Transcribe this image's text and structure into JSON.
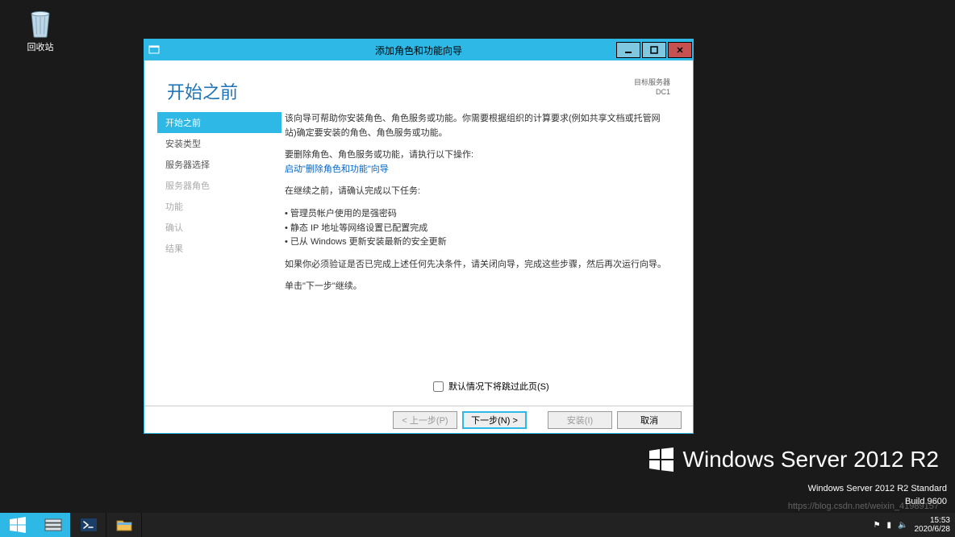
{
  "desktop": {
    "recycle_label": "回收站"
  },
  "brand": {
    "text": "Windows Server 2012 R2"
  },
  "status": {
    "edition": "Windows Server 2012 R2 Standard",
    "build": "Build 9600"
  },
  "dialog": {
    "title": "添加角色和功能向导",
    "page_title": "开始之前",
    "target_label": "目标服务器",
    "target_name": "DC1",
    "sidebar": [
      {
        "label": "开始之前",
        "state": "active"
      },
      {
        "label": "安装类型",
        "state": "done"
      },
      {
        "label": "服务器选择",
        "state": "done"
      },
      {
        "label": "服务器角色",
        "state": "disabled"
      },
      {
        "label": "功能",
        "state": "disabled"
      },
      {
        "label": "确认",
        "state": "disabled"
      },
      {
        "label": "结果",
        "state": "disabled"
      }
    ],
    "intro": "该向导可帮助你安装角色、角色服务或功能。你需要根据组织的计算要求(例如共享文档或托管网站)确定要安装的角色、角色服务或功能。",
    "remove_label": "要删除角色、角色服务或功能，请执行以下操作:",
    "remove_link": "启动\"删除角色和功能\"向导",
    "tasks_label": "在继续之前，请确认完成以下任务:",
    "tasks": [
      "管理员帐户使用的是强密码",
      "静态 IP 地址等网络设置已配置完成",
      "已从 Windows 更新安装最新的安全更新"
    ],
    "verify": "如果你必须验证是否已完成上述任何先决条件，请关闭向导，完成这些步骤，然后再次运行向导。",
    "continue": "单击\"下一步\"继续。",
    "skip": "默认情况下将跳过此页(S)",
    "buttons": {
      "prev": "< 上一步(P)",
      "next": "下一步(N) >",
      "install": "安装(I)",
      "cancel": "取消"
    }
  },
  "taskbar": {
    "time": "15:53",
    "date": "2020/6/28"
  },
  "watermark": "https://blog.csdn.net/weixin_41989157"
}
